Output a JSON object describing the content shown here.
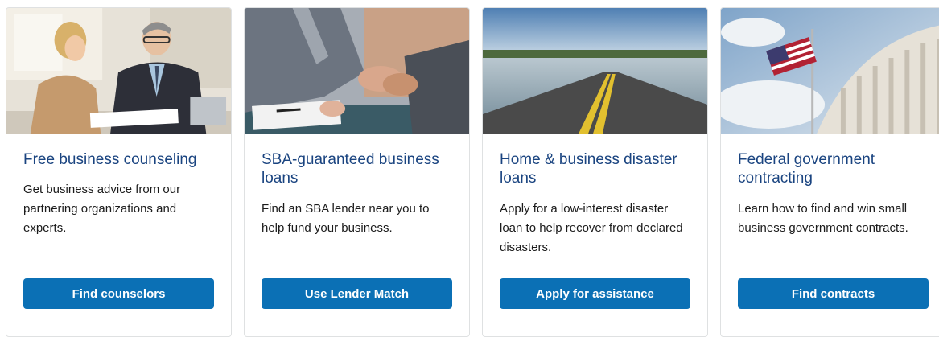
{
  "cards": [
    {
      "title": "Free business counseling",
      "description": "Get business advice from our partnering organizations and experts.",
      "button_label": "Find counselors",
      "image": "business-counseling-photo"
    },
    {
      "title": "SBA-guaranteed business loans",
      "description": "Find an SBA lender near you to help fund your business.",
      "button_label": "Use Lender Match",
      "image": "handshake-photo"
    },
    {
      "title": "Home & business disaster loans",
      "description": "Apply for a low-interest disaster loan to help recover from declared disasters.",
      "button_label": "Apply for assistance",
      "image": "flooded-road-photo"
    },
    {
      "title": "Federal government contracting",
      "description": "Learn how to find and win small business government contracts.",
      "button_label": "Find contracts",
      "image": "capitol-flag-photo"
    }
  ],
  "colors": {
    "title": "#1a4480",
    "button": "#0b70b5",
    "border": "#dfe1e2"
  }
}
